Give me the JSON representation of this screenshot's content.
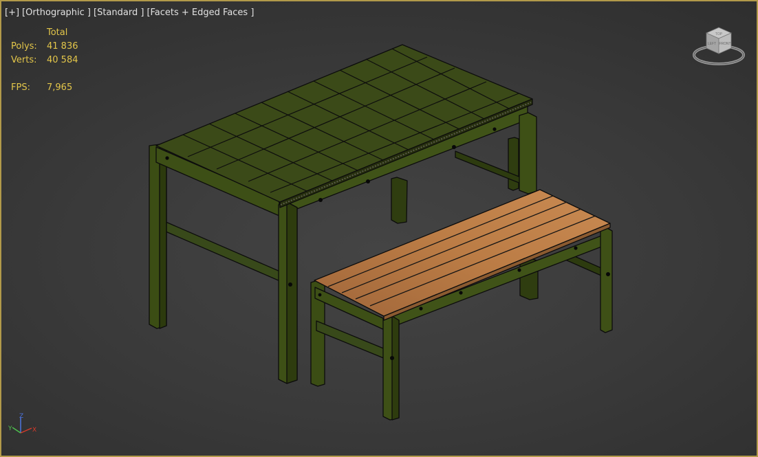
{
  "viewport": {
    "labels": [
      "[+]",
      "[Orthographic ]",
      "[Standard ]",
      "[Facets + Edged Faces ]"
    ],
    "border_color": "#b29a4a"
  },
  "stats": {
    "header": "Total",
    "polys_label": "Polys:",
    "polys_value": "41 836",
    "verts_label": "Verts:",
    "verts_value": "40 584",
    "fps_label": "FPS:",
    "fps_value": "7,965",
    "text_color": "#e3c64a"
  },
  "scene": {
    "objects": [
      "table-tabletop",
      "table-frame",
      "bench-seat",
      "bench-frame"
    ],
    "frame_color": "#3b4d14",
    "wood_color": "#b07440"
  },
  "viewcube": {
    "face_labels": [
      "TOP",
      "LEFT",
      "FRONT"
    ],
    "icon": "viewcube-icon"
  },
  "axis_tripod": {
    "x": "X",
    "y": "Y",
    "z": "Z",
    "x_color": "#d83a2a",
    "y_color": "#4ec24e",
    "z_color": "#4d74e0"
  }
}
